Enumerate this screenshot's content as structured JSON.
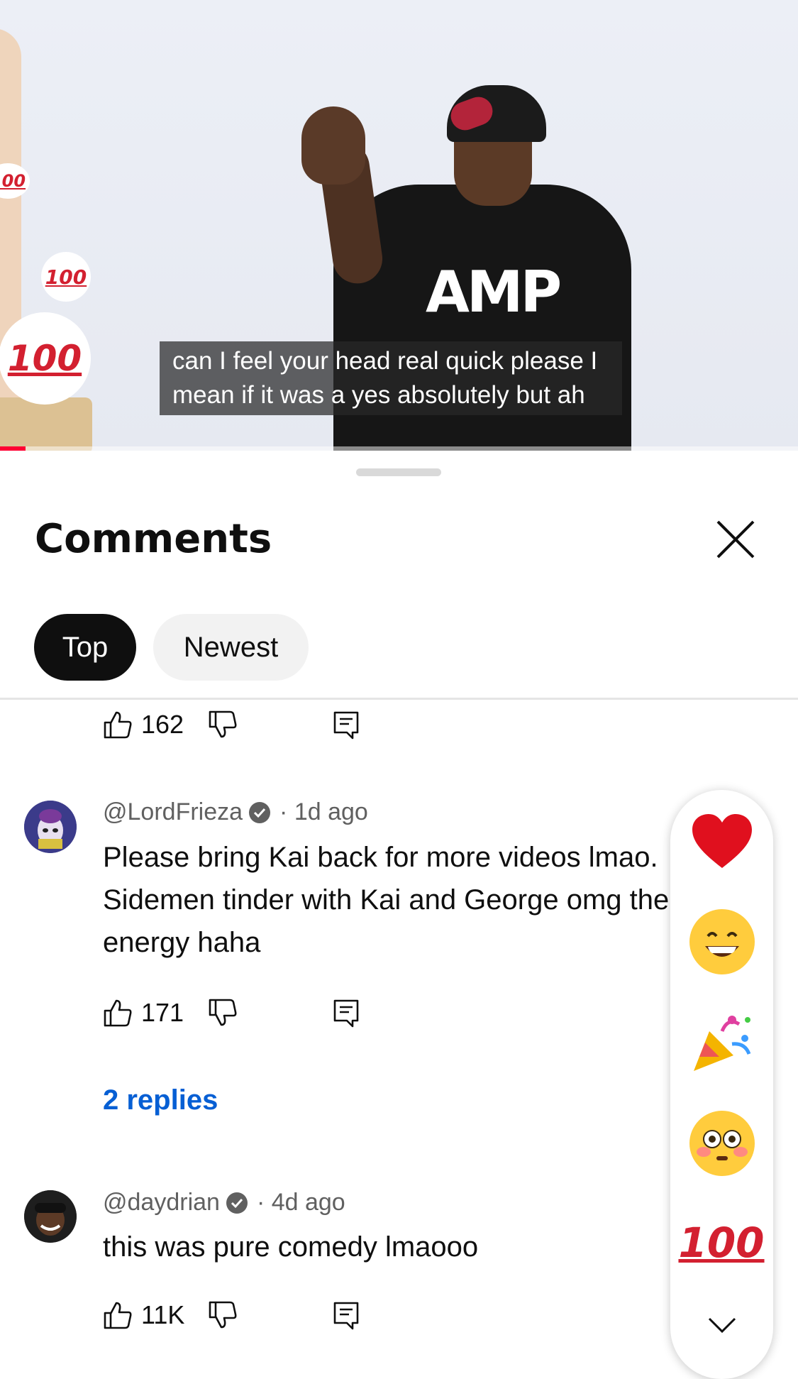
{
  "video": {
    "caption": "can I feel your head real quick please I mean if it was a yes absolutely but ah",
    "hoodie_text": "AMP",
    "floating_emoji": "100"
  },
  "panel": {
    "title": "Comments",
    "filters": [
      "Top",
      "Newest"
    ]
  },
  "comments": [
    {
      "likes": "162"
    },
    {
      "author": "@LordFrieza",
      "time": "1d ago",
      "text": "Please bring Kai back for more videos lmao. Sidemen tinder with Kai and George omg the energy haha",
      "likes": "171",
      "replies_label": "2 replies"
    },
    {
      "author": "@daydrian",
      "time": "4d ago",
      "text": "this was pure comedy lmaooo",
      "likes": "11K"
    }
  ],
  "reactions": [
    "heart-emoji",
    "grinning-face-emoji",
    "party-popper-emoji",
    "flushed-face-emoji",
    "hundred-points-emoji",
    "chevron-down-icon"
  ],
  "colors": {
    "accent_red": "#ff0033",
    "link_blue": "#065fd4",
    "chip_active": "#0f0f0f",
    "chip_inactive": "#f2f2f2"
  }
}
